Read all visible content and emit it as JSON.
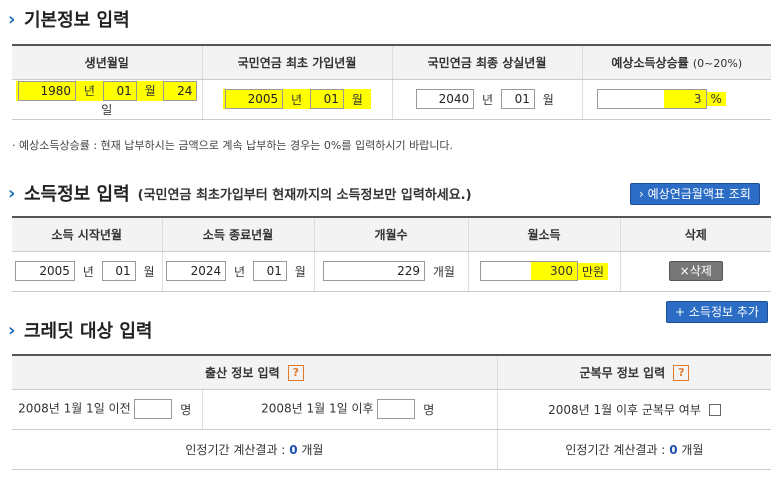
{
  "basic": {
    "title": "기본정보 입력",
    "headers": [
      "생년월일",
      "국민연금 최초 가입년월",
      "국민연금 최종 상실년월",
      "예상소득상승률"
    ],
    "rate_hint": "(0~20%)",
    "birth": {
      "year": "1980",
      "year_unit": "년",
      "month": "01",
      "month_unit": "월",
      "day": "24",
      "day_unit": "일"
    },
    "first_join": {
      "year": "2005",
      "year_unit": "년",
      "month": "01",
      "month_unit": "월"
    },
    "last_loss": {
      "year": "2040",
      "year_unit": "년",
      "month": "01",
      "month_unit": "월"
    },
    "growth_rate": {
      "value": "3",
      "unit": "%"
    },
    "note": "· 예상소득상승률 : 현재 납부하시는 금액으로 계속 납부하는 경우는 0%를 입력하시기 바랍니다."
  },
  "income": {
    "title": "소득정보 입력",
    "subtitle": "(국민연금 최초가입부터 현재까지의 소득정보만 입력하세요.)",
    "lookup_button": "› 예상연금월액표 조회",
    "headers": [
      "소득 시작년월",
      "소득 종료년월",
      "개월수",
      "월소득",
      "삭제"
    ],
    "row": {
      "start_year": "2005",
      "start_year_unit": "년",
      "start_month": "01",
      "start_month_unit": "월",
      "end_year": "2024",
      "end_year_unit": "년",
      "end_month": "01",
      "end_month_unit": "월",
      "months": "229",
      "months_unit": "개월",
      "monthly_income": "300",
      "income_unit": "만원",
      "delete_label": "×삭제"
    },
    "add_button": "+ 소득정보 추가"
  },
  "credit": {
    "title": "크레딧 대상 입력",
    "birth_header": "출산 정보 입력",
    "military_header": "군복무 정보 입력",
    "help_glyph": "?",
    "before_label": "2008년 1월 1일 이전",
    "after_label": "2008년 1월 1일 이후",
    "person_unit": "명",
    "military_label": "2008년 1월 이후 군복무 여부",
    "result_label": "인정기간 계산결과 :",
    "birth_result": "0",
    "military_result": "0",
    "result_unit": "개월"
  }
}
